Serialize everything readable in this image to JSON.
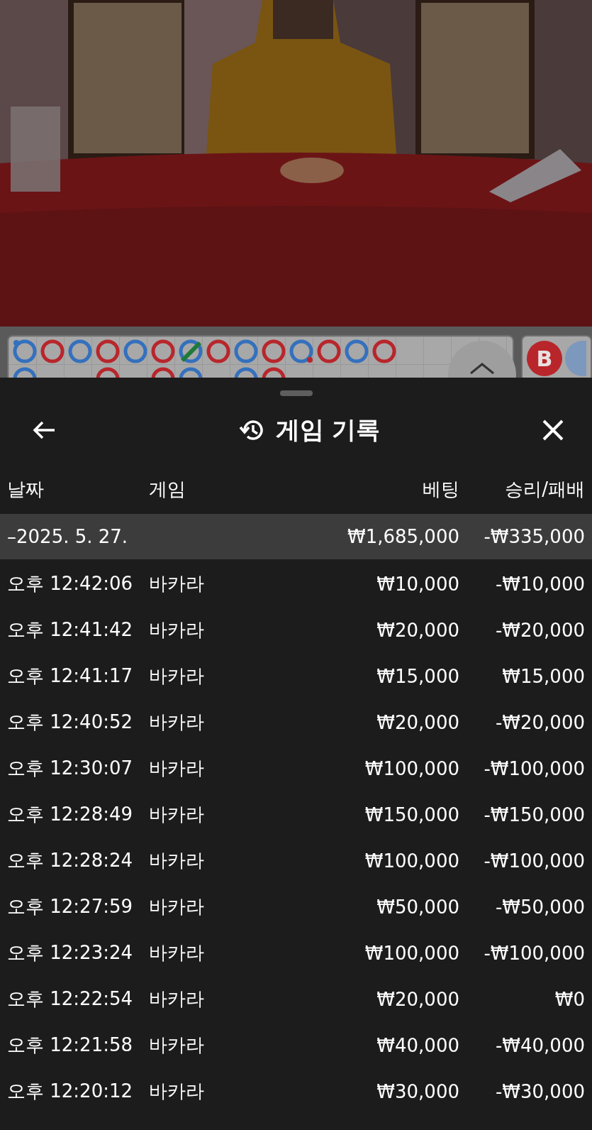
{
  "bead_road": {
    "rows": [
      [
        {
          "color": "#3470bd",
          "tie": false,
          "dot": {
            "color": "#3470bd"
          }
        },
        {
          "color": "#b8262b",
          "tie": false
        },
        {
          "color": "#3470bd",
          "tie": false
        },
        {
          "color": "#b8262b",
          "tie": false
        },
        {
          "color": "#3470bd",
          "tie": false
        },
        {
          "color": "#b8262b",
          "tie": false
        },
        {
          "color": "#3470bd",
          "tie": true
        },
        {
          "color": "#b8262b",
          "tie": false
        },
        {
          "color": "#3470bd",
          "tie": false
        },
        {
          "color": "#b8262b",
          "tie": false
        },
        {
          "color": "#3470bd",
          "tie": false,
          "dot": {
            "color": "#b8262b"
          }
        },
        {
          "color": "#b8262b",
          "tie": false
        },
        {
          "color": "#3470bd",
          "tie": false
        },
        {
          "color": "#b8262b",
          "tie": false
        }
      ],
      [
        {
          "color": "#3470bd",
          "tie": false
        },
        null,
        null,
        {
          "color": "#b8262b",
          "tie": false
        },
        null,
        {
          "color": "#b8262b",
          "tie": false
        },
        {
          "color": "#3470bd",
          "tie": false
        },
        null,
        {
          "color": "#3470bd",
          "tie": false
        },
        {
          "color": "#b8262b",
          "tie": false
        }
      ]
    ]
  },
  "side_panel": {
    "badge": "B"
  },
  "sheet": {
    "title": "게임 기록",
    "columns": [
      "날짜",
      "게임",
      "베팅",
      "승리/패배"
    ],
    "group": {
      "label": "–2025. 5. 27.",
      "bet": "₩1,685,000",
      "result": "-₩335,000"
    },
    "rows": [
      {
        "time": "오후 12:42:06",
        "game": "바카라",
        "bet": "₩10,000",
        "result": "-₩10,000"
      },
      {
        "time": "오후 12:41:42",
        "game": "바카라",
        "bet": "₩20,000",
        "result": "-₩20,000"
      },
      {
        "time": "오후 12:41:17",
        "game": "바카라",
        "bet": "₩15,000",
        "result": "₩15,000"
      },
      {
        "time": "오후 12:40:52",
        "game": "바카라",
        "bet": "₩20,000",
        "result": "-₩20,000"
      },
      {
        "time": "오후 12:30:07",
        "game": "바카라",
        "bet": "₩100,000",
        "result": "-₩100,000"
      },
      {
        "time": "오후 12:28:49",
        "game": "바카라",
        "bet": "₩150,000",
        "result": "-₩150,000"
      },
      {
        "time": "오후 12:28:24",
        "game": "바카라",
        "bet": "₩100,000",
        "result": "-₩100,000"
      },
      {
        "time": "오후 12:27:59",
        "game": "바카라",
        "bet": "₩50,000",
        "result": "-₩50,000"
      },
      {
        "time": "오후 12:23:24",
        "game": "바카라",
        "bet": "₩100,000",
        "result": "-₩100,000"
      },
      {
        "time": "오후 12:22:54",
        "game": "바카라",
        "bet": "₩20,000",
        "result": "₩0"
      },
      {
        "time": "오후 12:21:58",
        "game": "바카라",
        "bet": "₩40,000",
        "result": "-₩40,000"
      },
      {
        "time": "오후 12:20:12",
        "game": "바카라",
        "bet": "₩30,000",
        "result": "-₩30,000"
      }
    ]
  }
}
